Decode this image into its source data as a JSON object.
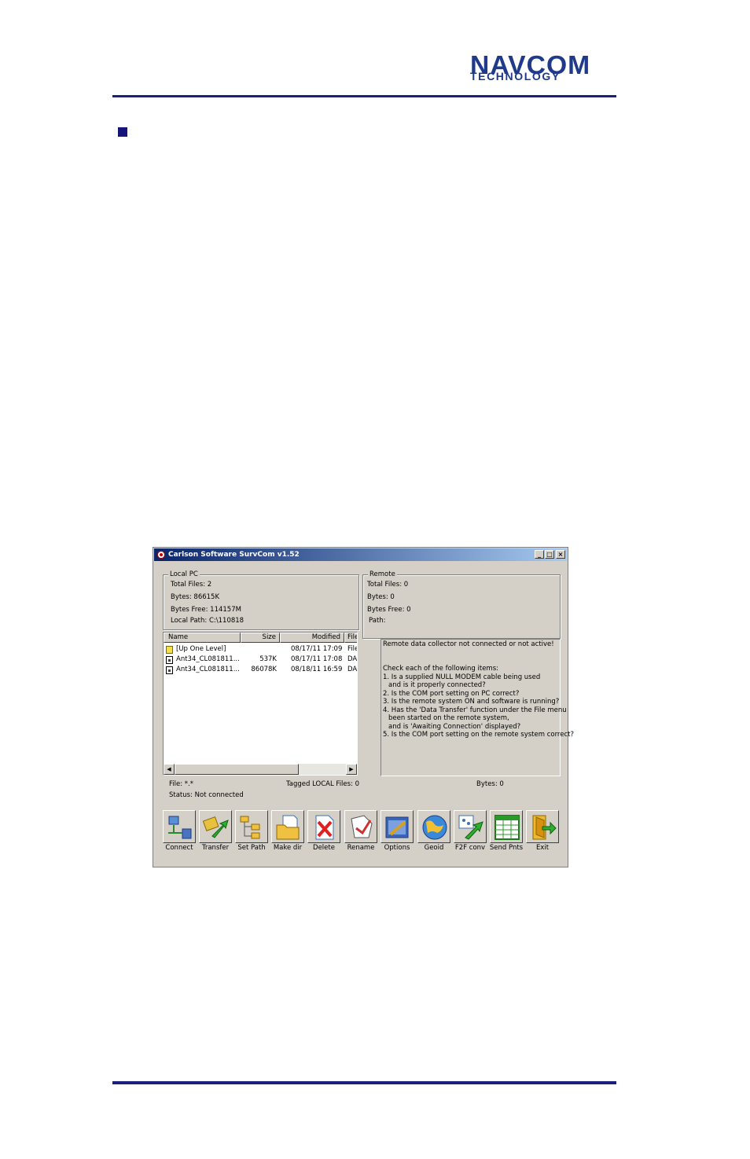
{
  "header": {
    "logo_line1": "NAVCOM",
    "logo_line2": "TECHNOLOGY",
    "brand_color": "#1f3a8a",
    "rule_color": "#1a1f7a"
  },
  "window": {
    "title": "Carlson Software SurvCom v1.52",
    "controls": {
      "minimize": "_",
      "maximize": "□",
      "close": "×"
    },
    "local": {
      "legend": "Local PC",
      "total_files": "Total Files: 2",
      "bytes": "Bytes: 86615K",
      "bytes_free": "Bytes Free: 114157M",
      "local_path": "Local Path: C:\\110818"
    },
    "remote": {
      "legend": "Remote",
      "total_files": "Total Files: 0",
      "bytes": "Bytes: 0",
      "bytes_free": "Bytes Free: 0",
      "path": "Path:"
    },
    "file_list": {
      "columns": [
        "Name",
        "Size",
        "Modified",
        "File"
      ],
      "rows": [
        {
          "icon": "folder-up-icon",
          "name": "[Up One Level]",
          "size": "",
          "modified": "08/17/11 17:09",
          "type": "File"
        },
        {
          "icon": "file-icon",
          "name": "Ant34_CL081811...",
          "size": "537K",
          "modified": "08/17/11 17:08",
          "type": "DA"
        },
        {
          "icon": "file-icon",
          "name": "Ant34_CL081811...",
          "size": "86078K",
          "modified": "08/18/11 16:59",
          "type": "DA"
        }
      ]
    },
    "message": {
      "lines": [
        "Remote data collector not connected or not active!",
        "",
        "Check each of the following items:",
        "1. Is a supplied NULL MODEM cable being used",
        "    and is it properly connected?",
        "2. Is the COM port setting on PC correct?",
        "3. Is the remote system ON and software is running?",
        "4. Has the 'Data Transfer' function under the File menu",
        "    been started on the remote system,",
        "    and is 'Awaiting Connection' displayed?",
        "5. Is the COM port setting on the remote system correct?"
      ]
    },
    "status": {
      "file": "File: *.*",
      "tagged": "Tagged LOCAL Files: 0",
      "bytes": "Bytes: 0",
      "status": "Status: Not connected"
    },
    "toolbar": [
      {
        "label": "Connect",
        "icon": "connect-icon"
      },
      {
        "label": "Transfer",
        "icon": "transfer-icon"
      },
      {
        "label": "Set Path",
        "icon": "set-path-icon"
      },
      {
        "label": "Make dir",
        "icon": "make-dir-icon"
      },
      {
        "label": "Delete",
        "icon": "delete-icon"
      },
      {
        "label": "Rename",
        "icon": "rename-icon"
      },
      {
        "label": "Options",
        "icon": "options-icon"
      },
      {
        "label": "Geoid",
        "icon": "geoid-icon"
      },
      {
        "label": "F2F conv",
        "icon": "f2f-conv-icon"
      },
      {
        "label": "Send Pnts",
        "icon": "send-pnts-icon"
      },
      {
        "label": "Exit",
        "icon": "exit-icon"
      }
    ]
  }
}
